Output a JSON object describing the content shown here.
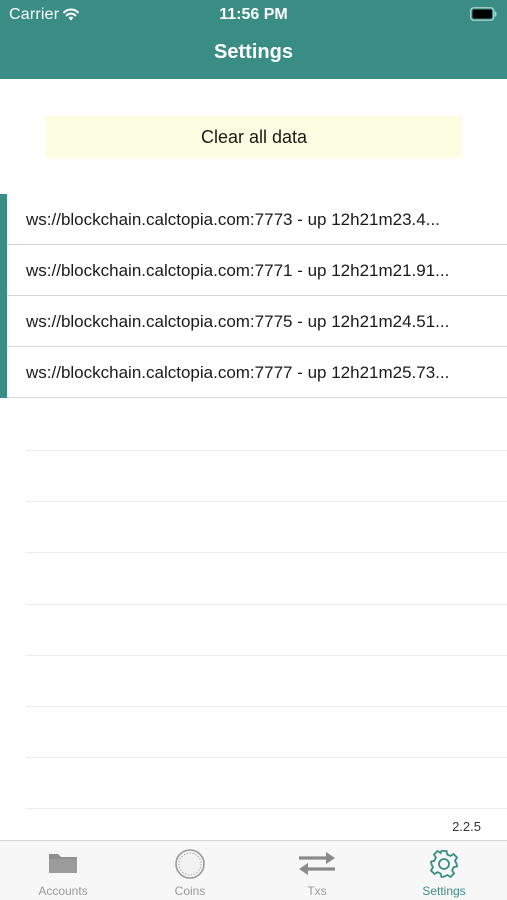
{
  "status_bar": {
    "carrier": "Carrier",
    "time": "11:56 PM"
  },
  "nav": {
    "title": "Settings"
  },
  "actions": {
    "clear_all_label": "Clear all data"
  },
  "nodes": [
    {
      "text": "ws://blockchain.calctopia.com:7773 - up 12h21m23.4..."
    },
    {
      "text": "ws://blockchain.calctopia.com:7771 - up 12h21m21.91..."
    },
    {
      "text": "ws://blockchain.calctopia.com:7775 - up 12h21m24.51..."
    },
    {
      "text": "ws://blockchain.calctopia.com:7777 - up 12h21m25.73..."
    }
  ],
  "version": "2.2.5",
  "tabbar": {
    "tabs": [
      {
        "label": "Accounts",
        "icon": "folder-icon",
        "active": false
      },
      {
        "label": "Coins",
        "icon": "coin-icon",
        "active": false
      },
      {
        "label": "Txs",
        "icon": "transfer-arrows-icon",
        "active": false
      },
      {
        "label": "Settings",
        "icon": "gear-icon",
        "active": true
      }
    ]
  },
  "colors": {
    "accent": "#3a8d85",
    "button_bg": "#fcfde1",
    "inactive_tab": "#9a9a9a"
  }
}
